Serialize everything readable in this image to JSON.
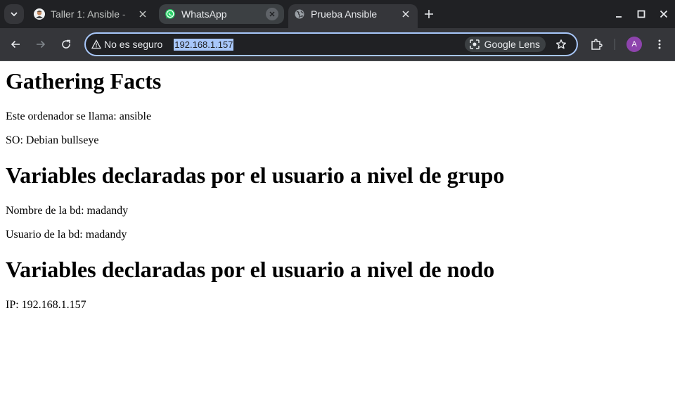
{
  "browser": {
    "tabs": [
      {
        "title": "Taller 1: Ansible - ",
        "favicon": "avatar-favicon",
        "active": false
      },
      {
        "title": "WhatsApp",
        "favicon": "whatsapp-icon",
        "active": false
      },
      {
        "title": "Prueba Ansible",
        "favicon": "globe-icon",
        "active": true
      }
    ],
    "security_label": "No es seguro",
    "url": "192.168.1.157",
    "lens_label": "Google Lens",
    "profile_initial": "A",
    "colors": {
      "tabstrip_bg": "#202124",
      "toolbar_bg": "#35363a",
      "omnibox_border": "#a8c7fa",
      "whatsapp_green": "#25d366",
      "avatar_purple": "#8e44ad"
    }
  },
  "page": {
    "heading_facts": "Gathering Facts",
    "hostname_line": "Este ordenador se llama: ansible",
    "os_line": "SO: Debian bullseye",
    "heading_group": "Variables declaradas por el usuario a nivel de grupo",
    "db_name_line": "Nombre de la bd: madandy",
    "db_user_line": "Usuario de la bd: madandy",
    "heading_node": "Variables declaradas por el usuario a nivel de nodo",
    "ip_line": "IP: 192.168.1.157"
  }
}
